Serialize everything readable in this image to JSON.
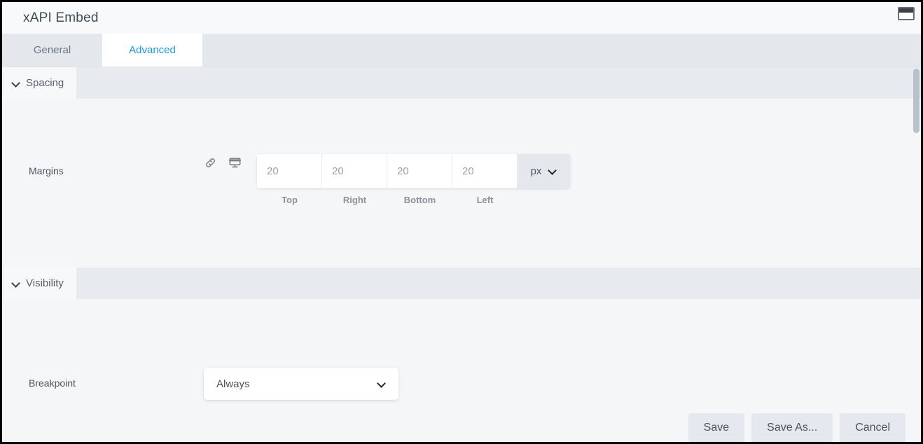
{
  "window": {
    "title": "xAPI Embed",
    "restore_icon": "window-restore-icon"
  },
  "tabs": [
    {
      "label": "General",
      "active": false
    },
    {
      "label": "Advanced",
      "active": true
    }
  ],
  "sections": {
    "spacing": {
      "title": "Spacing",
      "expanded": true,
      "margins": {
        "label": "Margins",
        "link_icon": "link-icon",
        "device_icon": "desktop-icon",
        "fields": [
          {
            "caption": "Top",
            "value": "20",
            "placeholder": "20"
          },
          {
            "caption": "Right",
            "value": "20",
            "placeholder": "20"
          },
          {
            "caption": "Bottom",
            "value": "20",
            "placeholder": "20"
          },
          {
            "caption": "Left",
            "value": "20",
            "placeholder": "20"
          }
        ],
        "unit": "px",
        "unit_chevron": "chevron-down-icon"
      }
    },
    "visibility": {
      "title": "Visibility",
      "expanded": true,
      "breakpoint": {
        "label": "Breakpoint",
        "value": "Always",
        "chevron": "chevron-down-icon"
      }
    }
  },
  "footer": {
    "save": "Save",
    "save_as": "Save As...",
    "cancel": "Cancel"
  },
  "colors": {
    "accent": "#1e97d4",
    "panel_bg": "#f4f6f8",
    "tabstrip_bg": "#e4e8ed",
    "section_header_bg": "#e7eaee",
    "button_bg": "#e5e8ee"
  }
}
